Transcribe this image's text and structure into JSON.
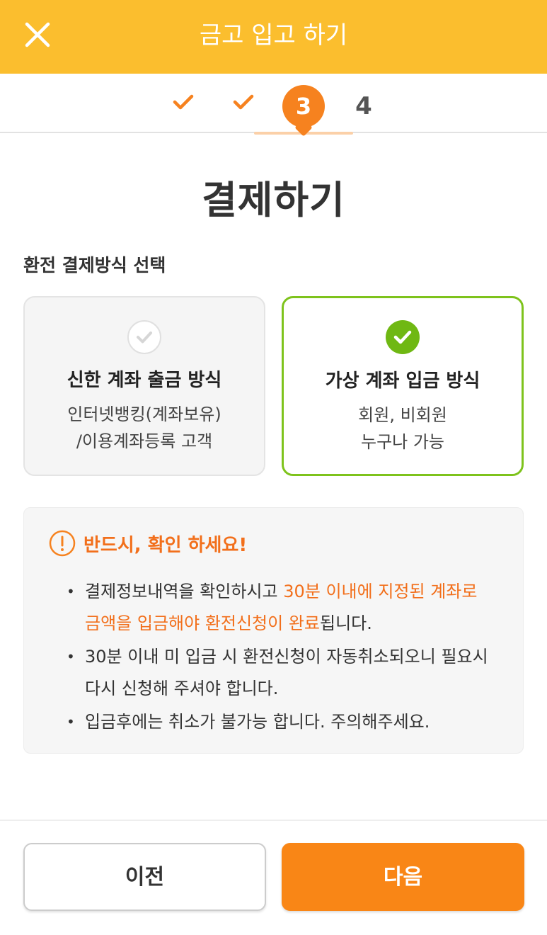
{
  "header": {
    "title": "금고 입고 하기",
    "close_icon": "close-icon"
  },
  "stepper": {
    "steps": [
      {
        "state": "done",
        "icon": "checkmark-icon"
      },
      {
        "state": "done",
        "icon": "checkmark-icon"
      },
      {
        "state": "active",
        "label": "3"
      },
      {
        "state": "upcoming",
        "label": "4"
      }
    ]
  },
  "page": {
    "title": "결제하기",
    "section_label": "환전 결제방식 선택"
  },
  "payment_options": [
    {
      "title": "신한 계좌 출금 방식",
      "desc_line1": "인터넷뱅킹(계좌보유)",
      "desc_line2": "/이용계좌등록 고객",
      "selected": false
    },
    {
      "title": "가상 계좌 입금 방식",
      "desc_line1": "회원, 비회원",
      "desc_line2": "누구나 가능",
      "selected": true
    }
  ],
  "notice": {
    "title": "반드시, 확인 하세요!",
    "icon": "exclamation-circle-icon",
    "bullet": "•",
    "items": [
      {
        "text_before": "결제정보내역을 확인하시고 ",
        "highlight": "30분 이내에 지정된 계좌로 금액을 입금해야 환전신청이 완료",
        "text_after": "됩니다."
      },
      {
        "text_before": "30분 이내 미 입금 시 환전신청이 자동취소되오니 필요시 다시 신청해 주셔야 합니다.",
        "highlight": "",
        "text_after": ""
      },
      {
        "text_before": "입금후에는 취소가 불가능 합니다. 주의해주세요.",
        "highlight": "",
        "text_after": ""
      }
    ]
  },
  "footer": {
    "prev_label": "이전",
    "next_label": "다음"
  },
  "colors": {
    "header_bg": "#FBBE2E",
    "accent_orange": "#F98616",
    "selected_green": "#7EC31C",
    "notice_highlight": "#F26F1B"
  }
}
